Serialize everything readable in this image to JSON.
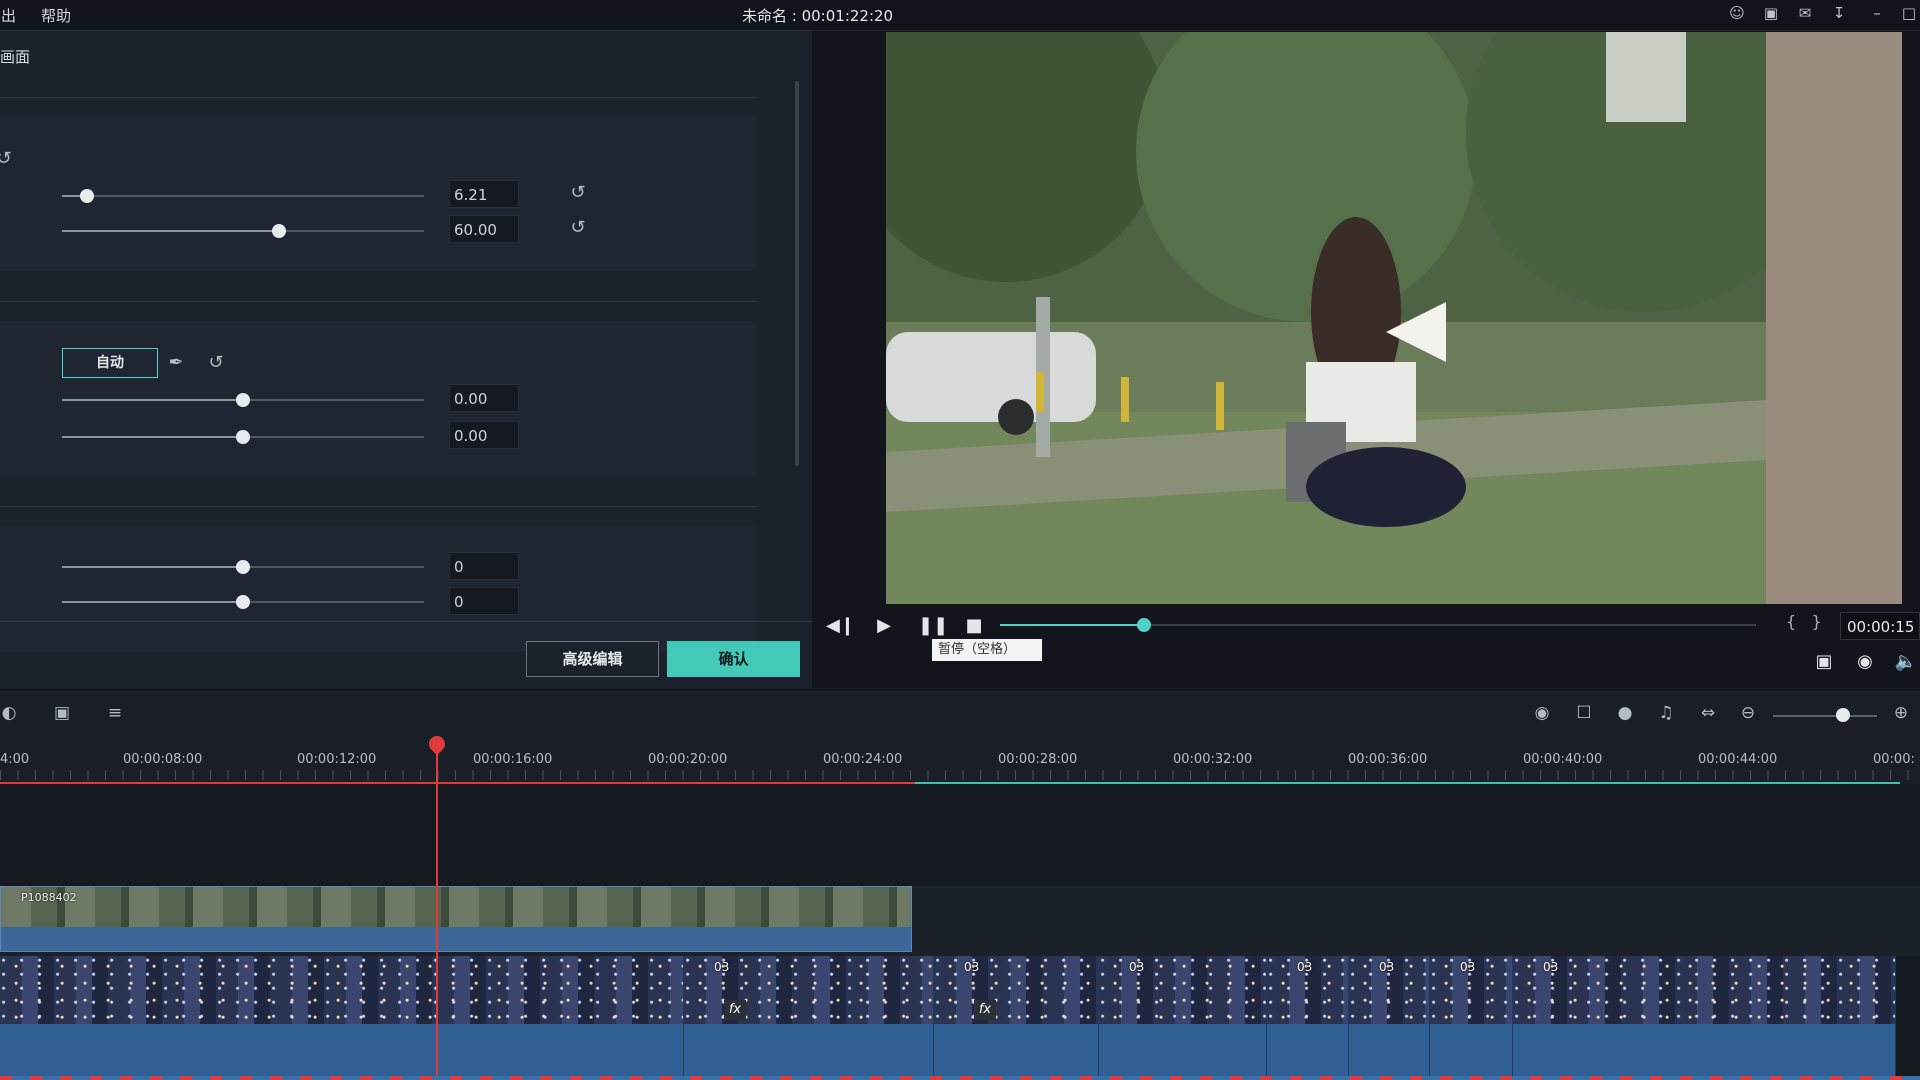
{
  "menubar": {
    "items": [
      "导出",
      "帮助"
    ],
    "window_title": "未命名 : 00:01:22:20",
    "icons": [
      "user-icon",
      "save-icon",
      "mail-icon",
      "download-icon",
      "minimize-icon",
      "maximize-icon"
    ]
  },
  "color_panel": {
    "title": "画面",
    "section1": {
      "slider1_value": "6.21",
      "slider1_level": 0.07,
      "slider2_value": "60.00",
      "slider2_level": 0.6
    },
    "section2": {
      "auto_label": "自动",
      "slider1_value": "0.00",
      "slider1_level": 0.5,
      "slider2_value": "0.00",
      "slider2_level": 0.5
    },
    "section3": {
      "slider1_value": "0",
      "slider1_level": 0.5,
      "slider2_value": "0",
      "slider2_level": 0.5
    },
    "advanced_edit_label": "高级编辑",
    "confirm_label": "确认"
  },
  "player": {
    "progress": 0.19,
    "timecode": "00:00:15",
    "tooltip": "暂停（空格）"
  },
  "timeline": {
    "ruler_labels": [
      "4:00",
      "00:00:08:00",
      "00:00:12:00",
      "00:00:16:00",
      "00:00:20:00",
      "00:00:24:00",
      "00:00:28:00",
      "00:00:32:00",
      "00:00:36:00",
      "00:00:40:00",
      "00:00:44:00",
      "00:00:"
    ],
    "zoom_level": 0.6,
    "clip1_name": "P1088402",
    "clip2_labels": [
      "03",
      "03",
      "03",
      "03",
      "03",
      "03",
      "03"
    ]
  },
  "colors": {
    "accent": "#42c9b8",
    "playhead": "#e03a3a",
    "clip_blue": "#2f5f93"
  }
}
